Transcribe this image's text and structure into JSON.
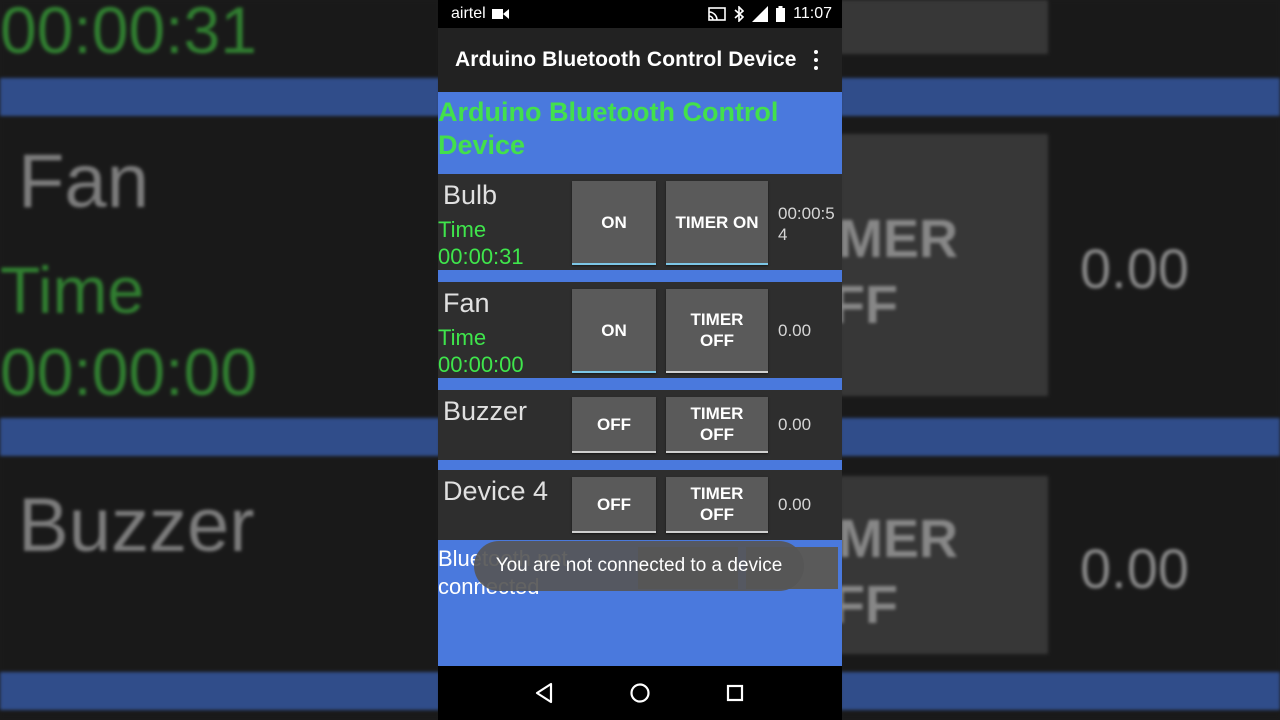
{
  "status_bar": {
    "carrier": "airtel",
    "time": "11:07"
  },
  "app_bar": {
    "title": "Arduino Bluetooth Control Device",
    "menu_icon": "overflow-menu-icon"
  },
  "header": {
    "title": "Arduino Bluetooth Control Device"
  },
  "devices": [
    {
      "name": "Bulb",
      "time_label": "Time",
      "time_value": "00:00:31",
      "state_label": "ON",
      "timer_label": "TIMER ON",
      "timer_value": "00:00:54"
    },
    {
      "name": "Fan",
      "time_label": "Time",
      "time_value": "00:00:00",
      "state_label": "ON",
      "timer_label": "TIMER OFF",
      "timer_value": "0.00"
    },
    {
      "name": "Buzzer",
      "state_label": "OFF",
      "timer_label": "TIMER OFF",
      "timer_value": "0.00"
    },
    {
      "name": "Device 4",
      "state_label": "OFF",
      "timer_label": "TIMER OFF",
      "timer_value": "0.00"
    }
  ],
  "bluetooth_status": "Bluetooth not connected",
  "toast": "You are not connected to a device",
  "background": {
    "left_fan": "Fan",
    "left_time": "Time",
    "left_time_value": "00:00:00",
    "left_top_time": "00:00:31",
    "left_buzzer": "Buzzer",
    "right_timer_off_1": "TIMER OFF",
    "right_value_1": "0.00",
    "right_timer_off_2": "TIMER OFF",
    "right_value_2": "0.00"
  },
  "colors": {
    "accent_blue": "#4a79dd",
    "time_green": "#43e04c",
    "row_bg": "#2e2e2e",
    "button_bg": "#5a5a5a"
  },
  "nav_icons": [
    "back-icon",
    "home-icon",
    "recents-icon"
  ]
}
